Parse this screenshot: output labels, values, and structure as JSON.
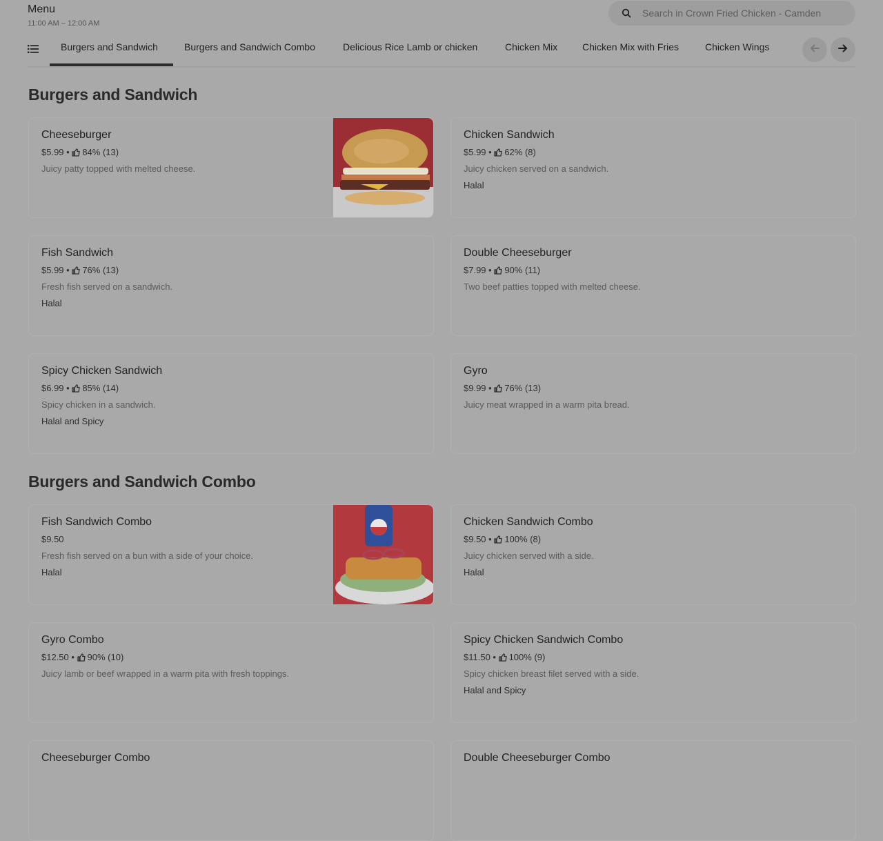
{
  "header": {
    "title": "Menu",
    "hours": "11:00 AM – 12:00 AM",
    "search_placeholder": "Search in Crown Fried Chicken - Camden"
  },
  "tabs": [
    {
      "label": "Burgers and Sandwich",
      "active": true
    },
    {
      "label": "Burgers and Sandwich Combo"
    },
    {
      "label": "Delicious Rice Lamb or chicken"
    },
    {
      "label": "Chicken Mix"
    },
    {
      "label": "Chicken Mix with Fries"
    },
    {
      "label": "Chicken Wings"
    }
  ],
  "sections": [
    {
      "title": "Burgers and Sandwich",
      "items": [
        {
          "name": "Cheeseburger",
          "price": "$5.99",
          "rating": "84% (13)",
          "desc": "Juicy patty topped with melted cheese.",
          "tag": "",
          "image": "burger-photo"
        },
        {
          "name": "Chicken Sandwich",
          "price": "$5.99",
          "rating": "62% (8)",
          "desc": "Juicy chicken served on a sandwich.",
          "tag": "Halal"
        },
        {
          "name": "Fish Sandwich",
          "price": "$5.99",
          "rating": "76% (13)",
          "desc": "Fresh fish served on a sandwich.",
          "tag": "Halal"
        },
        {
          "name": "Double Cheeseburger",
          "price": "$7.99",
          "rating": "90% (11)",
          "desc": "Two beef patties topped with melted cheese.",
          "tag": ""
        },
        {
          "name": "Spicy Chicken Sandwich",
          "price": "$6.99",
          "rating": "85% (14)",
          "desc": "Spicy chicken in a sandwich.",
          "tag": "Halal and Spicy"
        },
        {
          "name": "Gyro",
          "price": "$9.99",
          "rating": "76% (13)",
          "desc": "Juicy meat wrapped in a warm pita bread.",
          "tag": ""
        }
      ]
    },
    {
      "title": "Burgers and Sandwich Combo",
      "items": [
        {
          "name": "Fish Sandwich Combo",
          "price": "$9.50",
          "rating": "",
          "desc": "Fresh fish served on a bun with a side of your choice.",
          "tag": "Halal",
          "image": "fish-combo-photo"
        },
        {
          "name": "Chicken Sandwich Combo",
          "price": "$9.50",
          "rating": "100% (8)",
          "desc": "Juicy chicken served with a side.",
          "tag": "Halal"
        },
        {
          "name": "Gyro Combo",
          "price": "$12.50",
          "rating": "90% (10)",
          "desc": "Juicy lamb or beef wrapped in a warm pita with fresh toppings.",
          "tag": ""
        },
        {
          "name": "Spicy Chicken Sandwich Combo",
          "price": "$11.50",
          "rating": "100% (9)",
          "desc": "Spicy chicken breast filet served with a side.",
          "tag": "Halal and Spicy"
        },
        {
          "name": "Cheeseburger Combo",
          "price": "",
          "rating": "",
          "desc": "",
          "tag": ""
        },
        {
          "name": "Double Cheeseburger Combo",
          "price": "",
          "rating": "",
          "desc": "",
          "tag": ""
        }
      ]
    }
  ],
  "icons": {
    "search": "search-icon",
    "list": "list-icon",
    "thumbs_up": "thumbs-up-icon",
    "prev": "arrow-left-icon",
    "next": "arrow-right-icon"
  }
}
